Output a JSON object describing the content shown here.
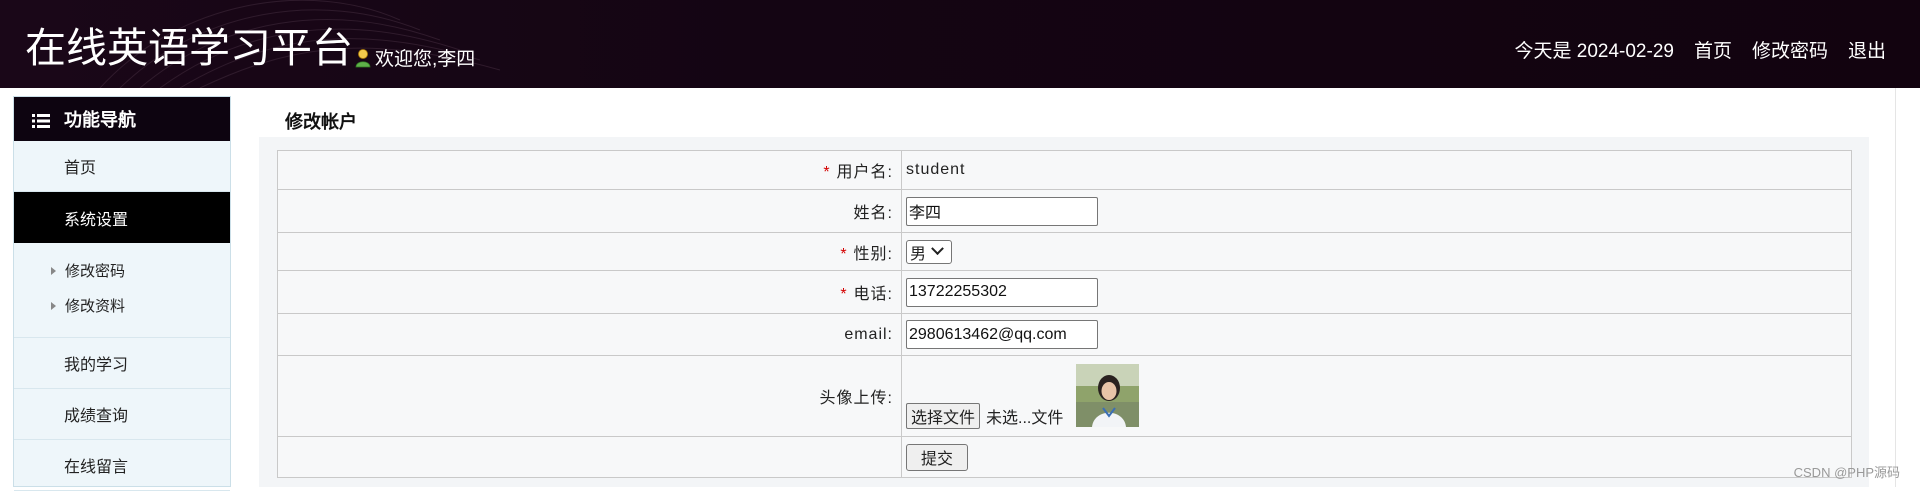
{
  "header": {
    "site_title": "在线英语学习平台",
    "welcome": "欢迎您,李四",
    "date_text": "今天是 2024-02-29",
    "links": [
      "首页",
      "修改密码",
      "退出"
    ]
  },
  "sidebar": {
    "title": "功能导航",
    "items": [
      {
        "label": "首页"
      },
      {
        "label": "系统设置",
        "active": true
      },
      {
        "label": "我的学习"
      },
      {
        "label": "成绩查询"
      },
      {
        "label": "在线留言"
      }
    ],
    "sub_items": [
      "修改密码",
      "修改资料"
    ]
  },
  "main": {
    "title": "修改帐户",
    "form": {
      "username_label": "用户名:",
      "username_value": "student",
      "name_label": "姓名:",
      "name_value": "李四",
      "sex_label": "性别:",
      "sex_value": "男",
      "phone_label": "电话:",
      "phone_value": "13722255302",
      "email_label": "email:",
      "email_value": "2980613462@qq.com",
      "avatar_label": "头像上传:",
      "file_button": "选择文件",
      "file_status": "未选...文件",
      "submit_label": "提交",
      "required_mark": "*"
    }
  },
  "watermark": "CSDN @PHP源码",
  "colors": {
    "header_bg": "#140513",
    "nav_active_bg": "#000000",
    "sidebar_bg": "#eef6fa",
    "required": "#d40000"
  }
}
